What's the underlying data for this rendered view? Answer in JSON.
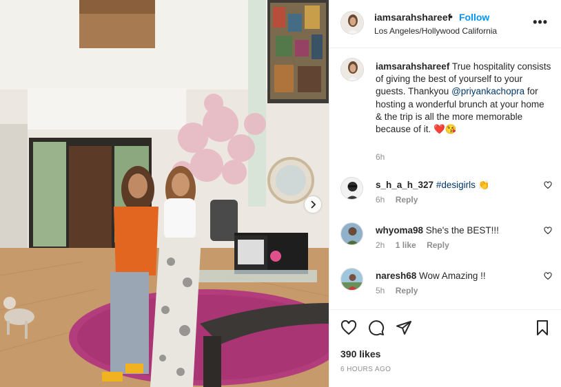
{
  "post": {
    "author": "iamsarahshareef",
    "dot": "•",
    "follow_label": "Follow",
    "location": "Los Angeles/Hollywood California",
    "more_label": "•••"
  },
  "caption": {
    "author": "iamsarahshareef",
    "text_before": " True hospitality consists of giving the best of yourself to your guests. Thankyou ",
    "mention": "@priyankachopra",
    "text_after": " for hosting a wonderful brunch at your home & the trip is all the more memorable because of it. ",
    "emojis": "❤️😘",
    "time": "6h"
  },
  "comments": [
    {
      "user": "s_h_a_h_327",
      "hashtag": "#desigirls",
      "text": " 👏",
      "time": "6h",
      "likes": "",
      "reply": "Reply"
    },
    {
      "user": "whyoma98",
      "hashtag": "",
      "text": " She's the BEST!!!",
      "time": "2h",
      "likes": "1 like",
      "reply": "Reply"
    },
    {
      "user": "naresh68",
      "hashtag": "",
      "text": " Wow Amazing !!",
      "time": "5h",
      "likes": "",
      "reply": "Reply"
    }
  ],
  "footer": {
    "likes": "390 likes",
    "ago": "6 HOURS AGO"
  },
  "icons": {
    "like": "heart-icon",
    "comment": "comment-icon",
    "share": "share-icon",
    "save": "bookmark-icon",
    "next": "chevron-right-icon"
  },
  "colors": {
    "accent": "#0095f6",
    "link": "#00376b",
    "muted": "#8e8e8e"
  }
}
